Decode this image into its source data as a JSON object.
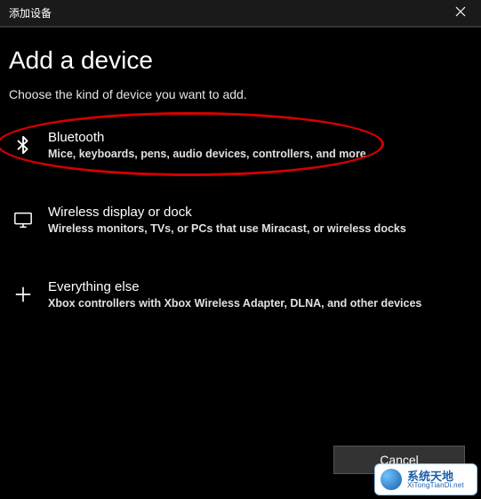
{
  "titlebar": {
    "title": "添加设备"
  },
  "heading": "Add a device",
  "subheading": "Choose the kind of device you want to add.",
  "options": [
    {
      "title": "Bluetooth",
      "desc": "Mice, keyboards, pens, audio devices, controllers, and more"
    },
    {
      "title": "Wireless display or dock",
      "desc": "Wireless monitors, TVs, or PCs that use Miracast, or wireless docks"
    },
    {
      "title": "Everything else",
      "desc": "Xbox controllers with Xbox Wireless Adapter, DLNA, and other devices"
    }
  ],
  "cancel_label": "Cancel",
  "watermark": {
    "cn": "系统天地",
    "en": "XiTongTianDi.net"
  }
}
